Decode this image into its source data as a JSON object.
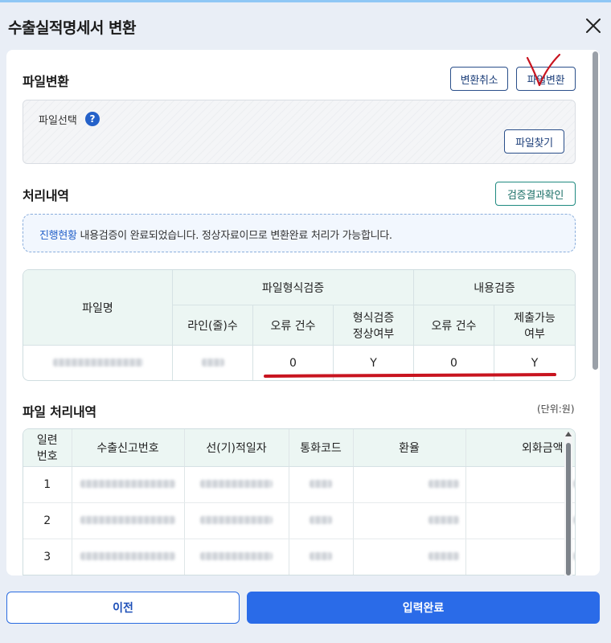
{
  "modal": {
    "title": "수출실적명세서 변환"
  },
  "file_section": {
    "title": "파일변환",
    "cancel_button": "변환취소",
    "convert_button": "파일변환",
    "file_select_label": "파일선택",
    "help_glyph": "?",
    "find_button": "파일찾기"
  },
  "process_section": {
    "title": "처리내역",
    "check_button": "검증결과확인",
    "notice_highlight": "진행현황",
    "notice_text": " 내용검증이 완료되었습니다. 정상자료이므로 변환완료 처리가 가능합니다."
  },
  "validation_table": {
    "headers": {
      "file_name": "파일명",
      "format_group": "파일형식검증",
      "content_group": "내용검증",
      "line_count": "라인(줄)수",
      "format_error_count": "오류 건수",
      "format_ok_line1": "형식검증",
      "format_ok_line2": "정상여부",
      "content_error_count": "오류 건수",
      "submit_ok_line1": "제출가능",
      "submit_ok_line2": "여부"
    },
    "row": {
      "format_error_count": "0",
      "format_ok": "Y",
      "content_error_count": "0",
      "submit_ok": "Y"
    }
  },
  "detail_section": {
    "title": "파일 처리내역",
    "unit": "(단위:원)",
    "headers": {
      "seq_line1": "일련",
      "seq_line2": "번호",
      "export_no": "수출신고번호",
      "ship_date": "선(기)적일자",
      "currency": "통화코드",
      "rate": "환율",
      "fx_amount": "외화금액"
    },
    "rows": [
      {
        "seq": "1"
      },
      {
        "seq": "2"
      },
      {
        "seq": "3"
      }
    ]
  },
  "footer": {
    "prev_button": "이전",
    "done_button": "입력완료"
  },
  "colors": {
    "primary": "#2a6be8",
    "navy_outline": "#2a4f8a",
    "teal_outline": "#1f8a80",
    "header_bg": "#ecf6f3",
    "annotation_red": "#c8141f"
  }
}
